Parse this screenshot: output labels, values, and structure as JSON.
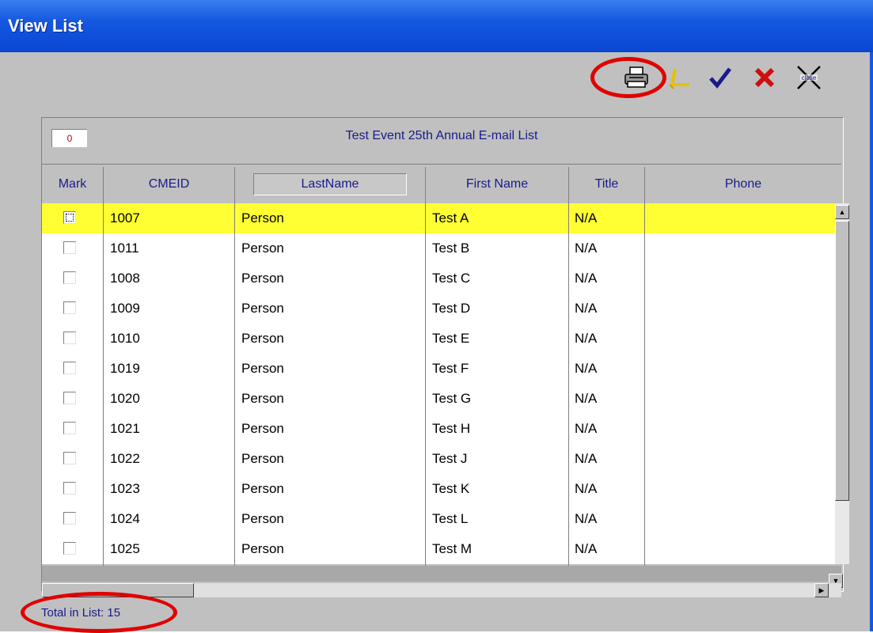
{
  "window": {
    "title": "View List"
  },
  "toolbar": {
    "icons": [
      "printer-icon",
      "sort-icon",
      "checkmark-icon",
      "x-delete-icon",
      "close-icon"
    ],
    "close_label": "close"
  },
  "list": {
    "counter": "0",
    "title": "Test Event 25th Annual E-mail List",
    "columns": [
      "Mark",
      "CMEID",
      "LastName",
      "First Name",
      "Title",
      "Phone"
    ],
    "rows": [
      {
        "cmeid": "1007",
        "last": "Person",
        "first": "Test A",
        "title": "N/A",
        "phone": ""
      },
      {
        "cmeid": "1011",
        "last": "Person",
        "first": "Test B",
        "title": "N/A",
        "phone": ""
      },
      {
        "cmeid": "1008",
        "last": "Person",
        "first": "Test C",
        "title": "N/A",
        "phone": ""
      },
      {
        "cmeid": "1009",
        "last": "Person",
        "first": "Test D",
        "title": "N/A",
        "phone": ""
      },
      {
        "cmeid": "1010",
        "last": "Person",
        "first": "Test E",
        "title": "N/A",
        "phone": ""
      },
      {
        "cmeid": "1019",
        "last": "Person",
        "first": "Test F",
        "title": "N/A",
        "phone": ""
      },
      {
        "cmeid": "1020",
        "last": "Person",
        "first": "Test G",
        "title": "N/A",
        "phone": ""
      },
      {
        "cmeid": "1021",
        "last": "Person",
        "first": "Test H",
        "title": "N/A",
        "phone": ""
      },
      {
        "cmeid": "1022",
        "last": "Person",
        "first": "Test J",
        "title": "N/A",
        "phone": ""
      },
      {
        "cmeid": "1023",
        "last": "Person",
        "first": "Test K",
        "title": "N/A",
        "phone": ""
      },
      {
        "cmeid": "1024",
        "last": "Person",
        "first": "Test L",
        "title": "N/A",
        "phone": ""
      },
      {
        "cmeid": "1025",
        "last": "Person",
        "first": "Test M",
        "title": "N/A",
        "phone": ""
      }
    ]
  },
  "footer": {
    "total": "Total in List: 15"
  },
  "colors": {
    "highlight_row": "#ffff33",
    "annotation_ring": "#e10000",
    "title_bar": "#1458e0"
  }
}
